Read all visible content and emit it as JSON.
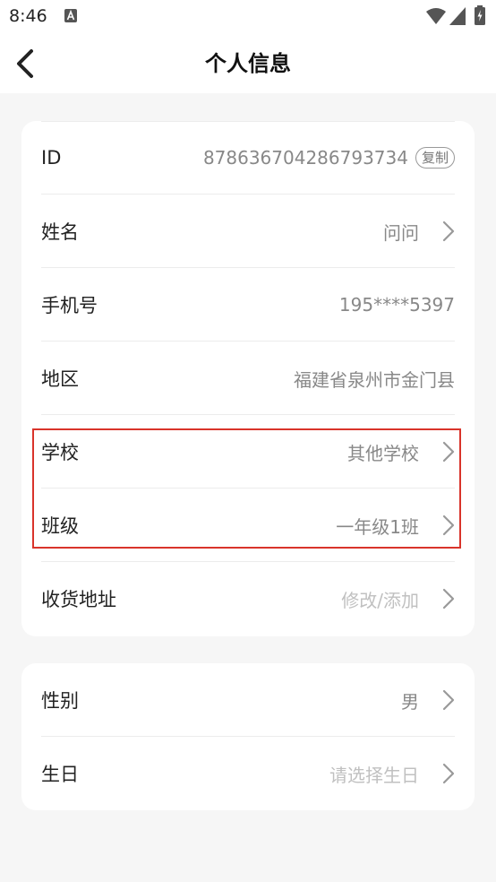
{
  "status_bar": {
    "time": "8:46",
    "notification_icon": "a-badge-icon",
    "wifi_icon": "wifi-icon",
    "signal_icon": "signal-icon",
    "battery_icon": "battery-charging-icon"
  },
  "nav": {
    "title": "个人信息",
    "back_icon": "chevron-left-icon"
  },
  "colors": {
    "highlight": "#d9342b",
    "background": "#f6f6f6",
    "card": "#ffffff"
  },
  "profile": {
    "id": {
      "label": "ID",
      "value": "878636704286793734",
      "copy_label": "复制"
    },
    "name": {
      "label": "姓名",
      "value": "问问"
    },
    "phone": {
      "label": "手机号",
      "value": "195****5397"
    },
    "region": {
      "label": "地区",
      "value": "福建省泉州市金门县"
    },
    "school": {
      "label": "学校",
      "value": "其他学校"
    },
    "class": {
      "label": "班级",
      "value": "一年级1班"
    },
    "address": {
      "label": "收货地址",
      "placeholder": "修改/添加"
    }
  },
  "personal": {
    "gender": {
      "label": "性别",
      "value": "男"
    },
    "birthday": {
      "label": "生日",
      "placeholder": "请选择生日"
    }
  }
}
